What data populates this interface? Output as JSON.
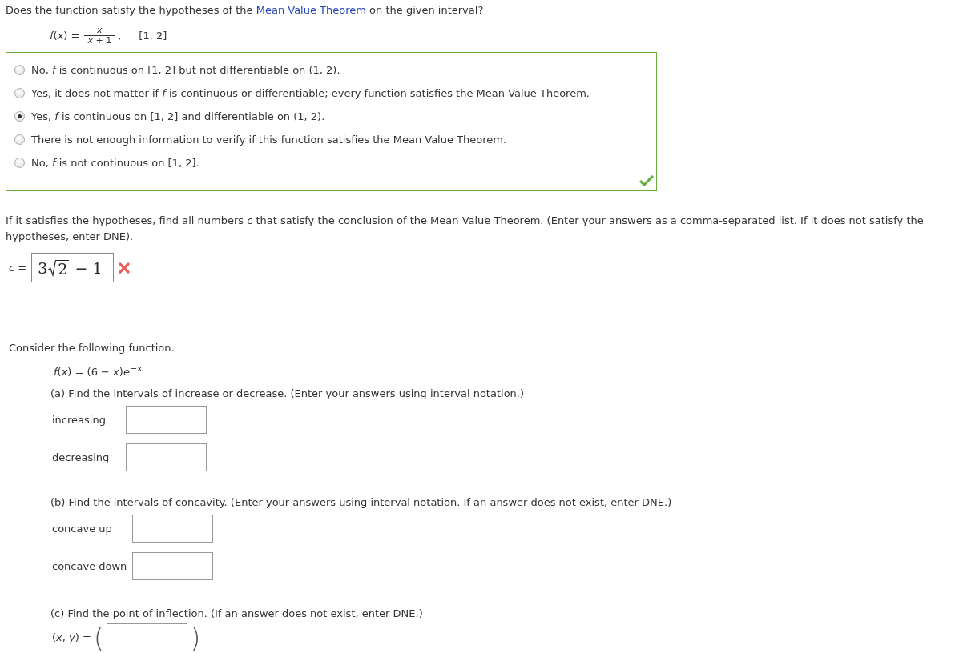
{
  "question_1": {
    "prompt": {
      "before": "Does the function satisfy the hypotheses of the ",
      "link": "Mean Value Theorem",
      "after": " on the given interval?"
    },
    "function": {
      "lhs": "*f*(*x*) =",
      "numerator": "*x*",
      "denominator": "*x* + 1",
      "separator": ",",
      "interval": "[1, 2]"
    },
    "options": [
      {
        "label": "No, *f* is continuous on [1, 2] but not differentiable on (1, 2).",
        "selected": false
      },
      {
        "label": "Yes, it does not matter if *f* is continuous or differentiable; every function satisfies the Mean Value Theorem.",
        "selected": false
      },
      {
        "label": "Yes, *f* is continuous on [1, 2] and differentiable on (1, 2).",
        "selected": true
      },
      {
        "label": "There is not enough information to verify if this function satisfies the Mean Value Theorem.",
        "selected": false
      },
      {
        "label": "No, *f* is not continuous on [1, 2].",
        "selected": false
      }
    ],
    "correct": true
  },
  "question_2": {
    "prompt": "If it satisfies the hypotheses, find all numbers *c* that satisfy the conclusion of the Mean Value Theorem. (Enter your answers as a comma-separated list. If it does not satisfy the hypotheses, enter DNE).",
    "label": "*c* =",
    "answer": {
      "coefficient": "3",
      "radicand": "2",
      "rest": "− 1"
    },
    "correct": false
  },
  "question_3": {
    "intro": "Consider the following function.",
    "function": "*f*(*x*) = (6 − *x*)*e*$^{−x}$",
    "parts": [
      {
        "prompt": "(a) Find the intervals of increase or decrease. (Enter your answers using interval notation.)",
        "fields": [
          {
            "label": "increasing"
          },
          {
            "label": "decreasing"
          }
        ]
      },
      {
        "prompt": "(b) Find the intervals of concavity. (Enter your answers using interval notation. If an answer does not exist, enter DNE.)",
        "fields": [
          {
            "label": "concave up"
          },
          {
            "label": "concave down"
          }
        ]
      },
      {
        "prompt": "(c) Find the point of inflection. (If an answer does not exist, enter DNE.)",
        "point": {
          "label": "(*x*, *y*) =",
          "open": "(",
          "close": ")"
        }
      }
    ]
  }
}
